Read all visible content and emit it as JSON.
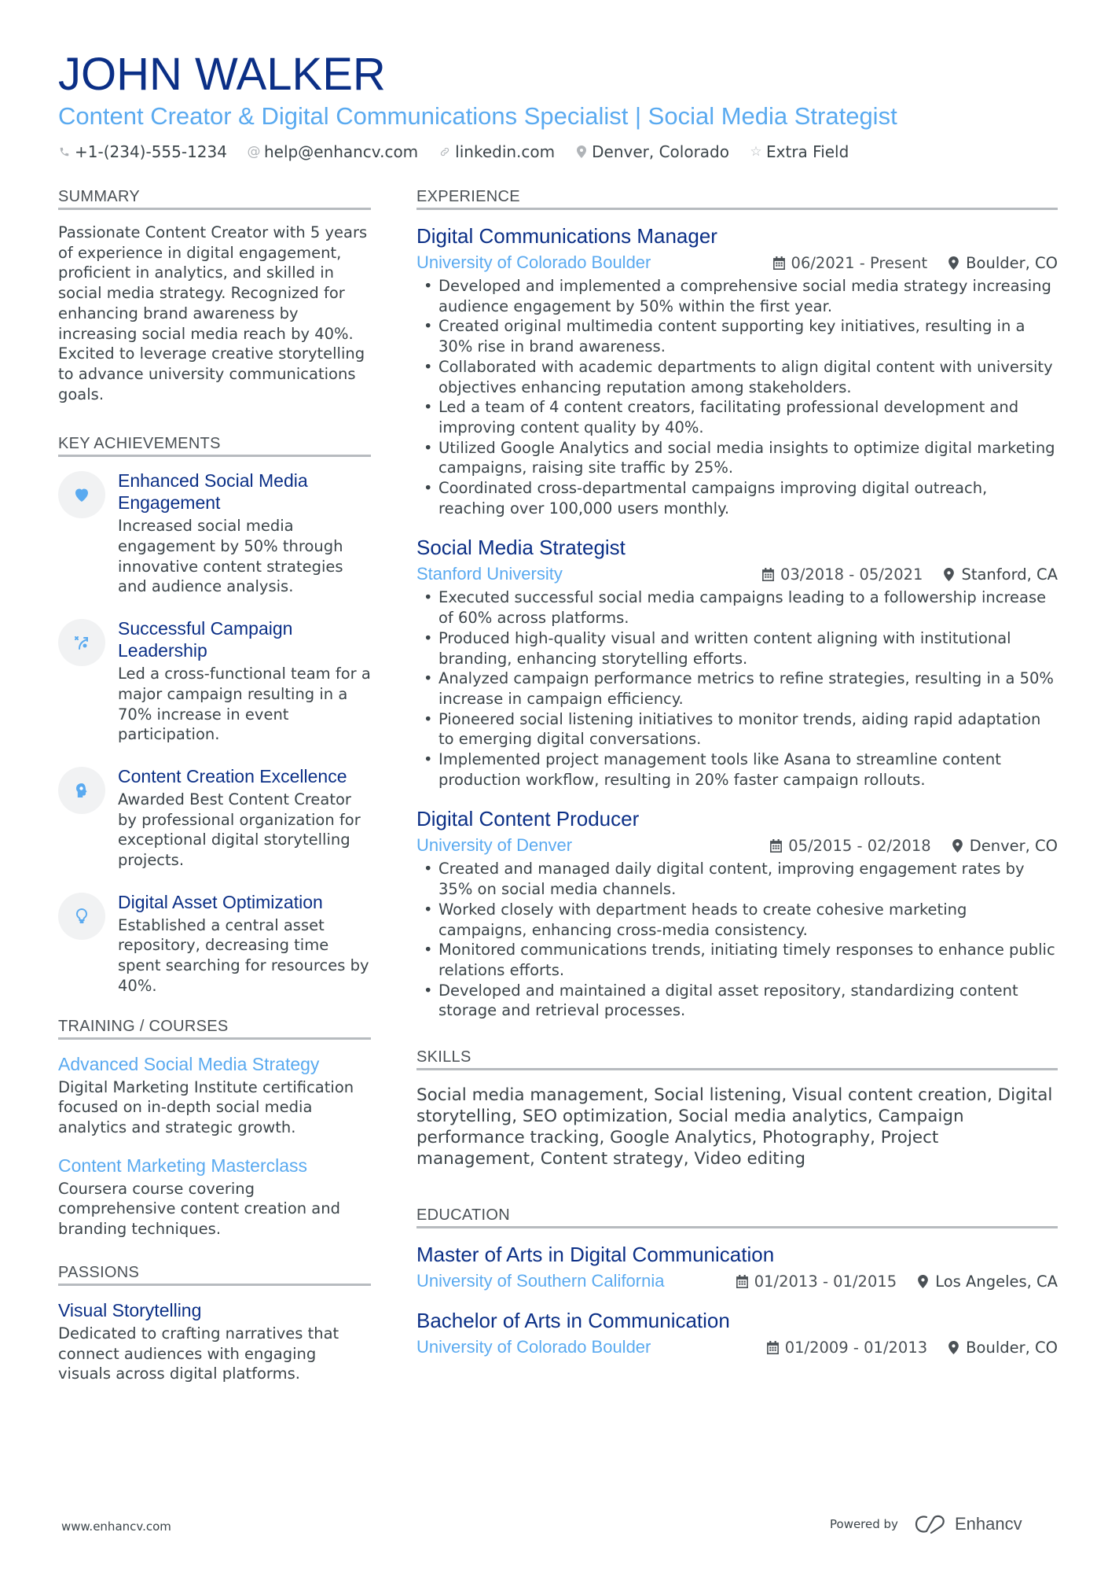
{
  "header": {
    "name": "JOHN WALKER",
    "title": "Content Creator & Digital Communications Specialist | Social Media Strategist",
    "contacts": [
      {
        "icon": "phone-icon",
        "text": "+1-(234)-555-1234"
      },
      {
        "icon": "at-icon",
        "text": "help@enhancv.com"
      },
      {
        "icon": "link-icon",
        "text": "linkedin.com"
      },
      {
        "icon": "location-pin-icon",
        "text": "Denver, Colorado"
      },
      {
        "icon": "star-icon",
        "text": "Extra Field"
      }
    ]
  },
  "summary": {
    "heading": "SUMMARY",
    "text": "Passionate Content Creator with 5 years of experience in digital engagement, proficient in analytics, and skilled in social media strategy. Recognized for enhancing brand awareness by increasing social media reach by 40%. Excited to leverage creative storytelling to advance university communications goals."
  },
  "achievements": {
    "heading": "KEY ACHIEVEMENTS",
    "items": [
      {
        "icon": "heart-icon",
        "title": "Enhanced Social Media Engagement",
        "text": "Increased social media engagement by 50% through innovative content strategies and audience analysis."
      },
      {
        "icon": "strategy-icon",
        "title": "Successful Campaign Leadership",
        "text": "Led a cross-functional team for a major campaign resulting in a 70% increase in event participation."
      },
      {
        "icon": "head-idea-icon",
        "title": "Content Creation Excellence",
        "text": "Awarded Best Content Creator by professional organization for exceptional digital storytelling projects."
      },
      {
        "icon": "lightbulb-icon",
        "title": "Digital Asset Optimization",
        "text": "Established a central asset repository, decreasing time spent searching for resources by 40%."
      }
    ]
  },
  "training": {
    "heading": "TRAINING / COURSES",
    "items": [
      {
        "title": "Advanced Social Media Strategy",
        "text": "Digital Marketing Institute certification focused on in-depth social media analytics and strategic growth."
      },
      {
        "title": "Content Marketing Masterclass",
        "text": "Coursera course covering comprehensive content creation and branding techniques."
      }
    ]
  },
  "passions": {
    "heading": "PASSIONS",
    "items": [
      {
        "title": "Visual Storytelling",
        "text": "Dedicated to crafting narratives that connect audiences with engaging visuals across digital platforms."
      }
    ]
  },
  "experience": {
    "heading": "EXPERIENCE",
    "jobs": [
      {
        "title": "Digital Communications Manager",
        "company": "University of Colorado Boulder",
        "dates": "06/2021 - Present",
        "location": "Boulder, CO",
        "bullets": [
          "Developed and implemented a comprehensive social media strategy increasing audience engagement by 50% within the first year.",
          "Created original multimedia content supporting key initiatives, resulting in a 30% rise in brand awareness.",
          "Collaborated with academic departments to align digital content with university objectives enhancing reputation among stakeholders.",
          "Led a team of 4 content creators, facilitating professional development and improving content quality by 40%.",
          "Utilized Google Analytics and social media insights to optimize digital marketing campaigns, raising site traffic by 25%.",
          "Coordinated cross-departmental campaigns improving digital outreach, reaching over 100,000 users monthly."
        ]
      },
      {
        "title": "Social Media Strategist",
        "company": "Stanford University",
        "dates": "03/2018 - 05/2021",
        "location": "Stanford, CA",
        "bullets": [
          "Executed successful social media campaigns leading to a followership increase of 60% across platforms.",
          "Produced high-quality visual and written content aligning with institutional branding, enhancing storytelling efforts.",
          "Analyzed campaign performance metrics to refine strategies, resulting in a 50% increase in campaign efficiency.",
          "Pioneered social listening initiatives to monitor trends, aiding rapid adaptation to emerging digital conversations.",
          "Implemented project management tools like Asana to streamline content production workflow, resulting in 20% faster campaign rollouts."
        ]
      },
      {
        "title": "Digital Content Producer",
        "company": "University of Denver",
        "dates": "05/2015 - 02/2018",
        "location": "Denver, CO",
        "bullets": [
          "Created and managed daily digital content, improving engagement rates by 35% on social media channels.",
          "Worked closely with department heads to create cohesive marketing campaigns, enhancing cross-media consistency.",
          "Monitored communications trends, initiating timely responses to enhance public relations efforts.",
          "Developed and maintained a digital asset repository, standardizing content storage and retrieval processes."
        ]
      }
    ]
  },
  "skills": {
    "heading": "SKILLS",
    "text": "Social media management, Social listening, Visual content creation, Digital storytelling, SEO optimization, Social media analytics, Campaign performance tracking, Google Analytics, Photography, Project management, Content strategy, Video editing"
  },
  "education": {
    "heading": "EDUCATION",
    "items": [
      {
        "degree": "Master of Arts in Digital Communication",
        "school": "University of Southern California",
        "dates": "01/2013 - 01/2015",
        "location": "Los Angeles, CA"
      },
      {
        "degree": "Bachelor of Arts in Communication",
        "school": "University of Colorado Boulder",
        "dates": "01/2009 - 01/2013",
        "location": "Boulder, CO"
      }
    ]
  },
  "footer": {
    "website": "www.enhancv.com",
    "powered_by": "Powered by",
    "brand": "Enhancv"
  },
  "colors": {
    "name": "#0b2f86",
    "accent": "#5aaaf0",
    "text": "#3b4449",
    "divider": "#b7bbbf",
    "icon_bg": "#f1f2f3"
  }
}
